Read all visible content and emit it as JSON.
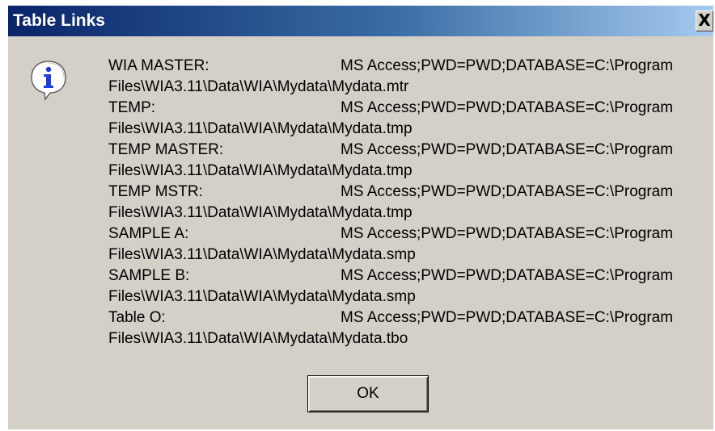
{
  "window": {
    "title": "Table Links",
    "close_glyph": "X"
  },
  "icon": {
    "name": "info-icon",
    "glyph": "i"
  },
  "links": [
    {
      "name": "WIA MASTER:",
      "connect": "MS Access;PWD=PWD;DATABASE=C:\\Program",
      "path": "Files\\WIA3.11\\Data\\WIA\\Mydata\\Mydata.mtr"
    },
    {
      "name": "TEMP:",
      "connect": "MS Access;PWD=PWD;DATABASE=C:\\Program",
      "path": "Files\\WIA3.11\\Data\\WIA\\Mydata\\Mydata.tmp"
    },
    {
      "name": "TEMP MASTER:",
      "connect": "MS Access;PWD=PWD;DATABASE=C:\\Program",
      "path": "Files\\WIA3.11\\Data\\WIA\\Mydata\\Mydata.tmp"
    },
    {
      "name": "TEMP MSTR:",
      "connect": "MS Access;PWD=PWD;DATABASE=C:\\Program",
      "path": "Files\\WIA3.11\\Data\\WIA\\Mydata\\Mydata.tmp"
    },
    {
      "name": "SAMPLE A:",
      "connect": "MS Access;PWD=PWD;DATABASE=C:\\Program",
      "path": "Files\\WIA3.11\\Data\\WIA\\Mydata\\Mydata.smp"
    },
    {
      "name": "SAMPLE B:",
      "connect": "MS Access;PWD=PWD;DATABASE=C:\\Program",
      "path": "Files\\WIA3.11\\Data\\WIA\\Mydata\\Mydata.smp"
    },
    {
      "name": "Table O:",
      "connect": "MS Access;PWD=PWD;DATABASE=C:\\Program",
      "path": "Files\\WIA3.11\\Data\\WIA\\Mydata\\Mydata.tbo"
    }
  ],
  "buttons": {
    "ok_label": "OK"
  },
  "colors": {
    "titlebar_start": "#0a246a",
    "titlebar_end": "#a6caf0",
    "dialog_face": "#d4d0c8",
    "icon_blue": "#1c3fd8"
  }
}
